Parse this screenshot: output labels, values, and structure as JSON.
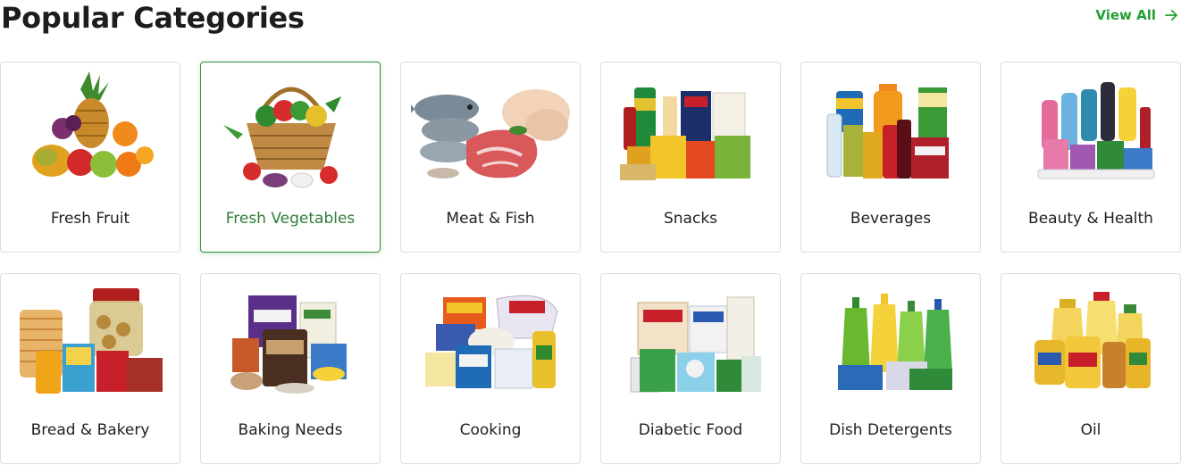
{
  "header": {
    "title": "Popular Categories",
    "view_all_label": "View All"
  },
  "categories": [
    {
      "label": "Fresh Fruit",
      "icon": "fruit-basket-icon",
      "active": false
    },
    {
      "label": "Fresh Vegetables",
      "icon": "vegetable-basket-icon",
      "active": true
    },
    {
      "label": "Meat & Fish",
      "icon": "meat-fish-icon",
      "active": false
    },
    {
      "label": "Snacks",
      "icon": "snacks-icon",
      "active": false
    },
    {
      "label": "Beverages",
      "icon": "beverages-icon",
      "active": false
    },
    {
      "label": "Beauty & Health",
      "icon": "beauty-health-icon",
      "active": false
    },
    {
      "label": "Bread & Bakery",
      "icon": "bread-bakery-icon",
      "active": false
    },
    {
      "label": "Baking Needs",
      "icon": "baking-needs-icon",
      "active": false
    },
    {
      "label": "Cooking",
      "icon": "cooking-icon",
      "active": false
    },
    {
      "label": "Diabetic Food",
      "icon": "diabetic-food-icon",
      "active": false
    },
    {
      "label": "Dish Detergents",
      "icon": "dish-detergent-icon",
      "active": false
    },
    {
      "label": "Oil",
      "icon": "oil-bottles-icon",
      "active": false
    }
  ],
  "colors": {
    "accent": "#23a035",
    "active_border": "#2f8f3a",
    "card_border": "#dddddd"
  }
}
